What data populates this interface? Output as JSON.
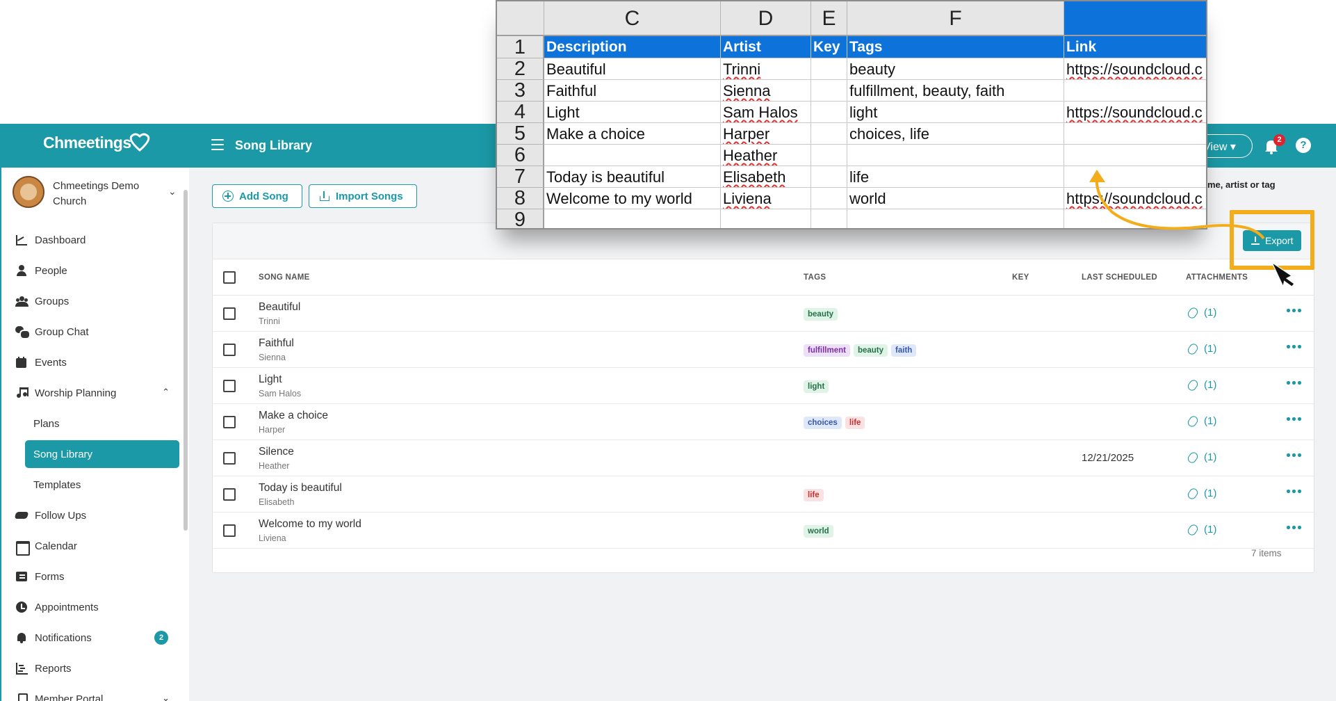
{
  "app": {
    "logo": "Chmeetings",
    "page_title": "Song Library",
    "view_label": "View",
    "notifications_count": "2",
    "help_label": "?"
  },
  "sidebar": {
    "church_name": "Chmeetings Demo Church",
    "items": [
      {
        "label": "Dashboard",
        "icon": "chart-line-icon"
      },
      {
        "label": "People",
        "icon": "person-icon"
      },
      {
        "label": "Groups",
        "icon": "users-icon"
      },
      {
        "label": "Group Chat",
        "icon": "chat-icon"
      },
      {
        "label": "Events",
        "icon": "calendar-icon"
      },
      {
        "label": "Worship Planning",
        "icon": "music-icon"
      },
      {
        "label": "Plans"
      },
      {
        "label": "Song Library"
      },
      {
        "label": "Templates"
      },
      {
        "label": "Follow Ups",
        "icon": "handshake-icon"
      },
      {
        "label": "Calendar",
        "icon": "calendar-grid-icon"
      },
      {
        "label": "Forms",
        "icon": "forms-icon"
      },
      {
        "label": "Appointments",
        "icon": "clock-icon"
      },
      {
        "label": "Notifications",
        "icon": "bell-icon",
        "badge": "2"
      },
      {
        "label": "Reports",
        "icon": "report-icon"
      },
      {
        "label": "Member Portal",
        "icon": "phone-icon"
      }
    ]
  },
  "toolbar": {
    "add_song": "Add Song",
    "import_songs": "Import Songs",
    "search_hint": "me, artist or tag",
    "export": "Export"
  },
  "table": {
    "headers": {
      "song_name": "SONG NAME",
      "tags": "TAGS",
      "key": "KEY",
      "last_scheduled": "LAST SCHEDULED",
      "attachments": "ATTACHMENTS"
    },
    "rows": [
      {
        "name": "Beautiful",
        "artist": "Trinni",
        "tags": [
          {
            "t": "beauty",
            "c": "green"
          }
        ],
        "last_scheduled": "",
        "attachments": "(1)"
      },
      {
        "name": "Faithful",
        "artist": "Sienna",
        "tags": [
          {
            "t": "fulfillment",
            "c": "purple"
          },
          {
            "t": "beauty",
            "c": "green"
          },
          {
            "t": "faith",
            "c": "blue"
          }
        ],
        "last_scheduled": "",
        "attachments": "(1)"
      },
      {
        "name": "Light",
        "artist": "Sam Halos",
        "tags": [
          {
            "t": "light",
            "c": "green"
          }
        ],
        "last_scheduled": "",
        "attachments": "(1)"
      },
      {
        "name": "Make a choice",
        "artist": "Harper",
        "tags": [
          {
            "t": "choices",
            "c": "blue"
          },
          {
            "t": "life",
            "c": "red"
          }
        ],
        "last_scheduled": "",
        "attachments": "(1)"
      },
      {
        "name": "Silence",
        "artist": "Heather",
        "tags": [],
        "last_scheduled": "12/21/2025",
        "attachments": "(1)"
      },
      {
        "name": "Today is beautiful",
        "artist": "Elisabeth",
        "tags": [
          {
            "t": "life",
            "c": "red"
          }
        ],
        "last_scheduled": "",
        "attachments": "(1)"
      },
      {
        "name": "Welcome to my world",
        "artist": "Liviena",
        "tags": [
          {
            "t": "world",
            "c": "green"
          }
        ],
        "last_scheduled": "",
        "attachments": "(1)"
      }
    ],
    "count": "7 items"
  },
  "sheet": {
    "col_letters": [
      "C",
      "D",
      "E",
      "F",
      ""
    ],
    "row_numbers": [
      "1",
      "2",
      "3",
      "4",
      "5",
      "6",
      "7",
      "8",
      "9"
    ],
    "header": [
      "Description",
      "Artist",
      "Key",
      "Tags",
      "Link"
    ],
    "rows": [
      [
        "Beautiful",
        "Trinni",
        "",
        "beauty",
        "https://soundcloud.c"
      ],
      [
        "Faithful",
        "Sienna",
        "",
        "fulfillment, beauty, faith",
        ""
      ],
      [
        "Light",
        "Sam Halos",
        "",
        "light",
        "https://soundcloud.c"
      ],
      [
        "Make a choice",
        "Harper",
        "",
        "choices, life",
        ""
      ],
      [
        "",
        "Heather",
        "",
        "",
        ""
      ],
      [
        "Today is beautiful",
        "Elisabeth",
        "",
        "life",
        ""
      ],
      [
        "Welcome to my world",
        "Liviena",
        "",
        "world",
        "https://soundcloud.c"
      ],
      [
        "",
        "",
        "",
        "",
        ""
      ]
    ]
  },
  "colors": {
    "brand": "#1b99a6",
    "highlight": "#f3ac1a",
    "sheet_header": "#0d72d9"
  }
}
